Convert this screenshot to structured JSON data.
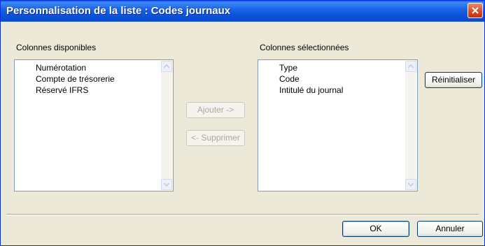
{
  "window": {
    "title": "Personnalisation de la liste : Codes journaux"
  },
  "available": {
    "label": "Colonnes disponibles",
    "items": [
      "Numérotation",
      "Compte de trésorerie",
      "Réservé IFRS"
    ]
  },
  "selected": {
    "label": "Colonnes sélectionnées",
    "items": [
      "Type",
      "Code",
      "Intitulé du journal"
    ]
  },
  "actions": {
    "add_label": "Ajouter ->",
    "remove_label": "<- Supprimer",
    "reset_label": "Réinitialiser"
  },
  "footer": {
    "ok_label": "OK",
    "cancel_label": "Annuler"
  },
  "colors": {
    "titlebar": "#0c54d8",
    "window_bg": "#ece9d8",
    "listbox_border": "#7f9db9",
    "disabled_text": "#aca899"
  }
}
